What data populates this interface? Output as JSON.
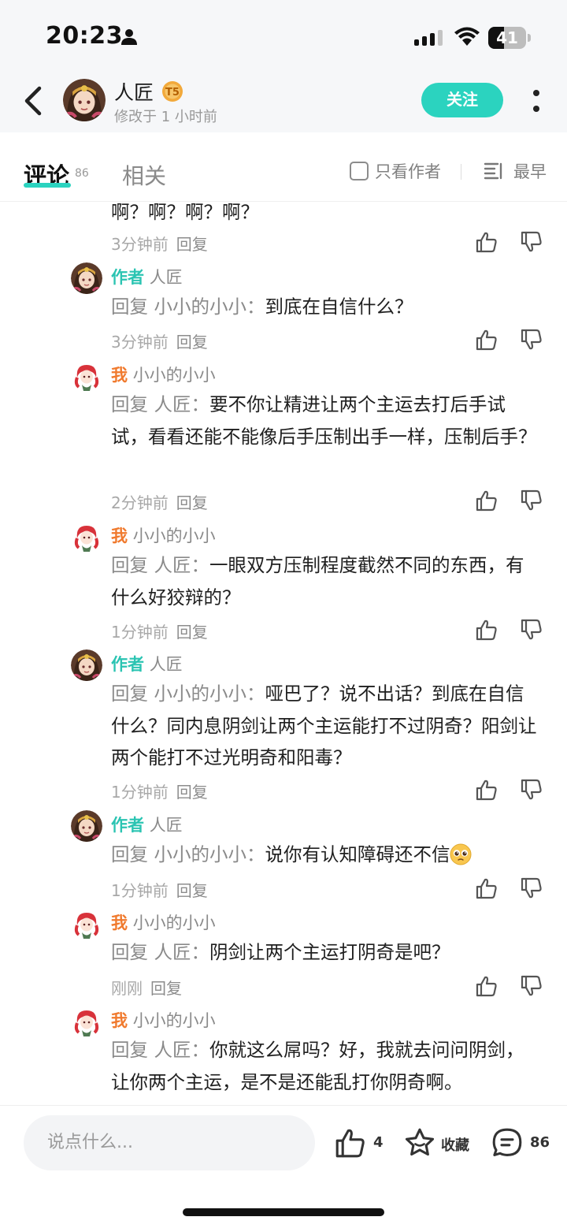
{
  "status_bar": {
    "time": "20:23",
    "battery": "41",
    "battery_level": 0.41
  },
  "header": {
    "author_name": "人匠",
    "badge_icon": "level-badge-icon",
    "subtitle": "修改于 1 小时前",
    "follow_label": "关注"
  },
  "tabs": {
    "comments_label": "评论",
    "comments_count": "86",
    "related_label": "相关",
    "only_author_label": "只看作者",
    "sort_label": "最早"
  },
  "comments": [
    {
      "text": "啊？啊？啊？啊？",
      "time": "3分钟前",
      "reply": "回复"
    },
    {
      "tag": "作者",
      "name": "人匠",
      "reply_prefix": "回复 小小的小小：",
      "text": "到底在自信什么？",
      "time": "3分钟前",
      "reply": "回复"
    },
    {
      "tag": "我",
      "name": "小小的小小",
      "reply_prefix": "回复 人匠：",
      "text": "要不你让精进让两个主运去打后手试试，看看还能不能像后手压制出手一样，压制后手？",
      "time": "2分钟前",
      "reply": "回复"
    },
    {
      "tag": "我",
      "name": "小小的小小",
      "reply_prefix": "回复 人匠：",
      "text": "一眼双方压制程度截然不同的东西，有什么好狡辩的？",
      "time": "1分钟前",
      "reply": "回复"
    },
    {
      "tag": "作者",
      "name": "人匠",
      "reply_prefix": "回复 小小的小小：",
      "text": "哑巴了？说不出话？到底在自信什么？同内息阴剑让两个主运能打不过阴奇？阳剑让两个能打不过光明奇和阳毒？",
      "time": "1分钟前",
      "reply": "回复"
    },
    {
      "tag": "作者",
      "name": "人匠",
      "reply_prefix": "回复 小小的小小：",
      "text": "说你有认知障碍还不信",
      "emoji": "pleading-face-icon",
      "time": "1分钟前",
      "reply": "回复"
    },
    {
      "tag": "我",
      "name": "小小的小小",
      "reply_prefix": "回复 人匠：",
      "text": "阴剑让两个主运打阴奇是吧？",
      "time": "刚刚",
      "reply": "回复"
    },
    {
      "tag": "我",
      "name": "小小的小小",
      "reply_prefix": "回复 人匠：",
      "text": "你就这么屌吗？好，我就去问问阴剑，让你两个主运，是不是还能乱打你阴奇啊。"
    }
  ],
  "bottom_bar": {
    "input_placeholder": "说点什么...",
    "like_count": "4",
    "favorite_label": "收藏",
    "comment_count": "86"
  },
  "colors": {
    "accent": "#2bd3bf",
    "author_tag": "#2bc4b2",
    "me_tag": "#f07a2e"
  }
}
